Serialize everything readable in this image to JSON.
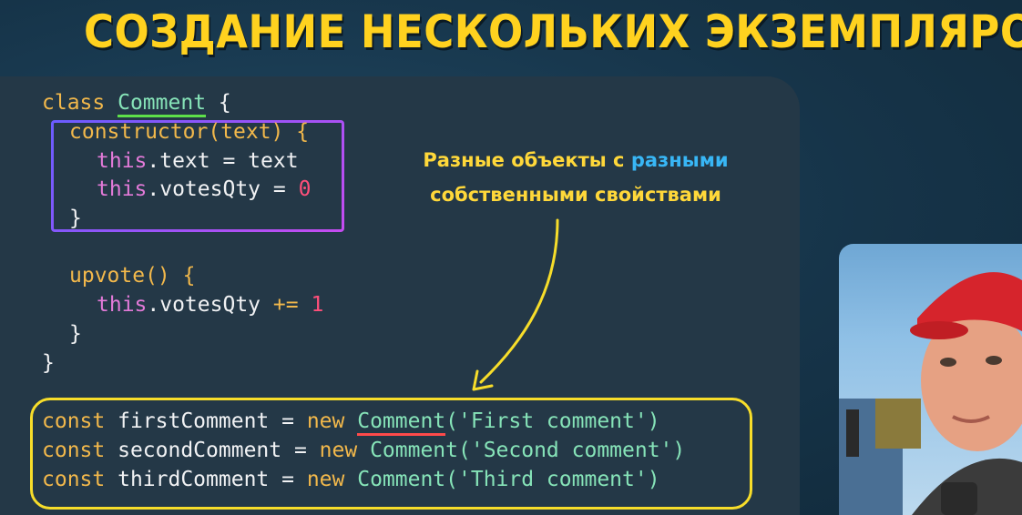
{
  "title": "СОЗДАНИЕ НЕСКОЛЬКИХ ЭКЗЕМПЛЯРОВ",
  "annotation": {
    "line1": "Разные объекты с ",
    "line1_highlight": "разными",
    "line2": "собственными свойствами"
  },
  "code": {
    "class_kw": "class",
    "class_name": "Comment",
    "open_brace": " {",
    "constructor": "constructor(text) {",
    "this_kw": "this",
    "text_assign": ".text = text",
    "votes_assign": ".votesQty = ",
    "zero": "0",
    "close_brace": "}",
    "upvote": "upvote() {",
    "votes_incr": ".votesQty ",
    "plus_eq": "+=",
    "one": "1",
    "const_kw": "const",
    "new_kw": "new",
    "lines": [
      {
        "var": " firstComment = ",
        "cls": "Comment",
        "arg": "('First comment')"
      },
      {
        "var": " secondComment = ",
        "cls": "Comment",
        "arg": "('Second comment')"
      },
      {
        "var": " thirdComment = ",
        "cls": "Comment",
        "arg": "('Third comment')"
      }
    ]
  },
  "colors": {
    "title": "#ffd21f",
    "keyword": "#f2b84b",
    "class_name": "#86e3b8",
    "this": "#e27ad8",
    "number": "#ff4f7a",
    "annotation": "#ffd83a",
    "annotation_highlight": "#38b6f5",
    "yellow_box": "#f7dd2a",
    "purple_box": "#8e4cf0"
  }
}
